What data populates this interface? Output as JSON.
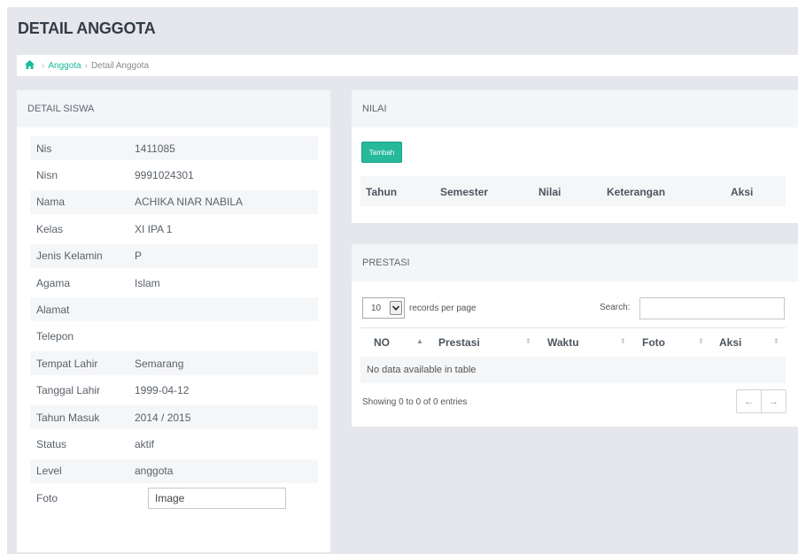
{
  "page_title": "DETAIL ANGGOTA",
  "breadcrumb": {
    "home_icon": "home-icon",
    "items": [
      "Anggota",
      "Detail Anggota"
    ]
  },
  "detail": {
    "heading": "DETAIL SISWA",
    "rows": [
      {
        "label": "Nis",
        "value": "1411085"
      },
      {
        "label": "Nisn",
        "value": "9991024301"
      },
      {
        "label": "Nama",
        "value": "ACHIKA NIAR NABILA"
      },
      {
        "label": "Kelas",
        "value": "XI IPA 1"
      },
      {
        "label": "Jenis Kelamin",
        "value": "P"
      },
      {
        "label": "Agama",
        "value": "Islam"
      },
      {
        "label": "Alamat",
        "value": ""
      },
      {
        "label": "Telepon",
        "value": ""
      },
      {
        "label": "Tempat Lahir",
        "value": "Semarang"
      },
      {
        "label": "Tanggal Lahir",
        "value": "1999-04-12"
      },
      {
        "label": "Tahun Masuk",
        "value": "2014 / 2015"
      },
      {
        "label": "Status",
        "value": "aktif"
      },
      {
        "label": "Level",
        "value": "anggota"
      },
      {
        "label": "Foto",
        "value": "Image"
      }
    ]
  },
  "nilai": {
    "heading": "NILAI",
    "add_button": "Tambah",
    "columns": [
      "Tahun",
      "Semester",
      "Nilai",
      "Keterangan",
      "Aksi"
    ]
  },
  "prestasi": {
    "heading": "PRESTASI",
    "page_size": "10",
    "records_label": "records per page",
    "search_label": "Search:",
    "search_value": "",
    "columns": [
      "NO",
      "Prestasi",
      "Waktu",
      "Foto",
      "Aksi"
    ],
    "empty_text": "No data available in table",
    "showing_text": "Showing 0 to 0 of 0 entries",
    "prev": "←",
    "next": "→"
  },
  "colors": {
    "accent": "#1abb9c",
    "button": "#26b99a",
    "background": "#e6e7ec"
  }
}
